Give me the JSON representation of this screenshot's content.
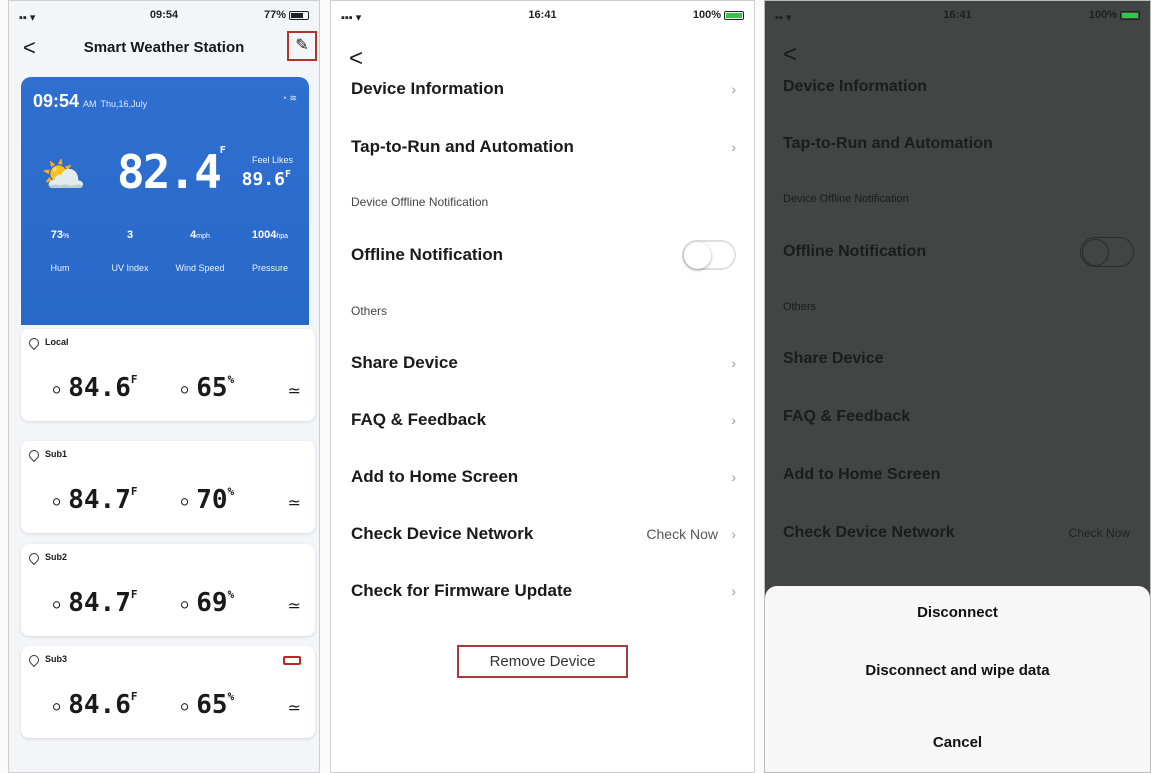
{
  "shot1": {
    "status": {
      "time": "09:54",
      "battery": "77%"
    },
    "nav": {
      "back": "<",
      "title": "Smart Weather Station"
    },
    "weather": {
      "time": "09:54",
      "ampm": "AM",
      "date": "Thu,16,July",
      "temp": "82.4",
      "temp_unit": "F",
      "feels_like_label": "Feel Likes",
      "feels_like": "89.6",
      "feels_like_unit": "F",
      "stats": [
        {
          "value": "73",
          "unit": "%",
          "label": "Hum"
        },
        {
          "value": "3",
          "unit": "",
          "label": "UV Index"
        },
        {
          "value": "4",
          "unit": "mph",
          "label": "Wind Speed"
        },
        {
          "value": "1004",
          "unit": "hpa",
          "label": "Pressure"
        }
      ]
    },
    "sensors": [
      {
        "name": "Local",
        "temp": "84.6",
        "temp_unit": "F",
        "hum": "65",
        "hum_unit": "%",
        "low_battery": false
      },
      {
        "name": "Sub1",
        "temp": "84.7",
        "temp_unit": "F",
        "hum": "70",
        "hum_unit": "%",
        "low_battery": false
      },
      {
        "name": "Sub2",
        "temp": "84.7",
        "temp_unit": "F",
        "hum": "69",
        "hum_unit": "%",
        "low_battery": false
      },
      {
        "name": "Sub3",
        "temp": "84.6",
        "temp_unit": "F",
        "hum": "65",
        "hum_unit": "%",
        "low_battery": true
      }
    ]
  },
  "shot2": {
    "status": {
      "time": "16:41",
      "battery": "100%"
    },
    "back": "<",
    "items": {
      "device_information": "Device Information",
      "tap_to_run": "Tap-to-Run and Automation",
      "offline_section": "Device Offline Notification",
      "offline_notification": "Offline Notification",
      "others_section": "Others",
      "share_device": "Share Device",
      "faq": "FAQ & Feedback",
      "add_home": "Add to Home Screen",
      "check_network": "Check Device Network",
      "check_now": "Check Now",
      "firmware": "Check for Firmware Update"
    },
    "remove_device": "Remove Device"
  },
  "shot3": {
    "status": {
      "time": "16:41",
      "battery": "100%"
    },
    "back": "<",
    "items": {
      "device_information": "Device Information",
      "tap_to_run": "Tap-to-Run and Automation",
      "offline_section": "Device Offline Notification",
      "offline_notification": "Offline Notification",
      "others_section": "Others",
      "share_device": "Share Device",
      "faq": "FAQ & Feedback",
      "add_home": "Add to Home Screen",
      "check_network": "Check Device Network",
      "check_now": "Check Now"
    },
    "sheet": {
      "disconnect": "Disconnect",
      "disconnect_wipe": "Disconnect and wipe data",
      "cancel": "Cancel"
    }
  },
  "colors": {
    "card_blue": "#2f6fd0",
    "highlight_red": "#b3332d",
    "dim_overlay": "#414543"
  }
}
